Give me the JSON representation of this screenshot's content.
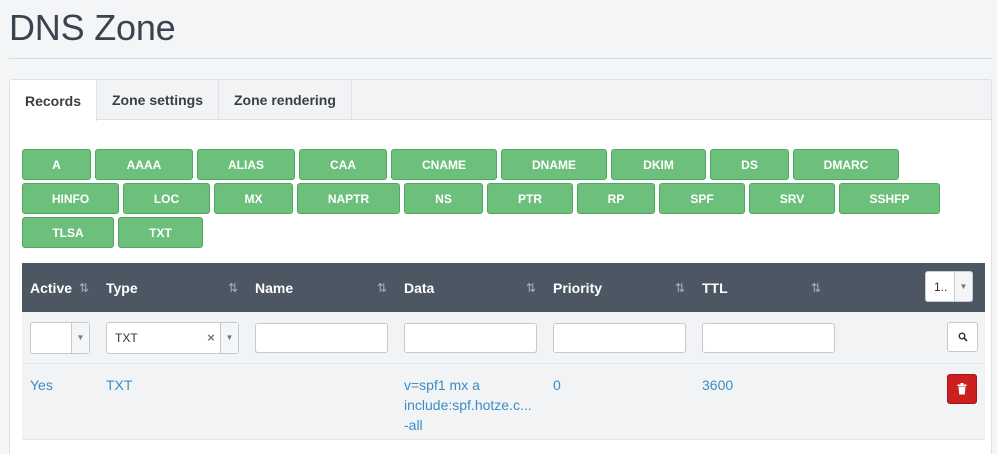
{
  "page": {
    "title": "DNS Zone"
  },
  "tabs": [
    {
      "label": "Records",
      "active": true
    },
    {
      "label": "Zone settings",
      "active": false
    },
    {
      "label": "Zone rendering",
      "active": false
    }
  ],
  "record_types": [
    [
      "A",
      "AAAA",
      "ALIAS",
      "CAA",
      "CNAME",
      "DNAME",
      "DKIM",
      "DS",
      "DMARC"
    ],
    [
      "HINFO",
      "LOC",
      "MX",
      "NAPTR",
      "NS",
      "PTR",
      "RP",
      "SPF",
      "SRV",
      "SSHFP"
    ],
    [
      "TLSA",
      "TXT"
    ]
  ],
  "grid": {
    "columns": {
      "active": "Active",
      "type": "Type",
      "name": "Name",
      "data": "Data",
      "priority": "Priority",
      "ttl": "TTL"
    },
    "page_size": "1..",
    "filters": {
      "active": "",
      "type": "TXT",
      "name": "",
      "data": "",
      "priority": "",
      "ttl": ""
    },
    "rows": [
      {
        "active": "Yes",
        "type": "TXT",
        "name": "",
        "data": [
          "v=spf1 mx a",
          "include:spf.hotze.c...",
          "-all"
        ],
        "priority": "0",
        "ttl": "3600"
      }
    ]
  },
  "icons": {
    "sort": "sort-icon",
    "search": "search-icon",
    "delete": "trash-icon",
    "chevron": "chevron-down-icon",
    "clear": "clear-icon"
  },
  "colors": {
    "record_type_button": "#6dbf7c",
    "grid_header": "#4c5763",
    "link": "#3c8dc5",
    "delete_button": "#cc1f1f"
  }
}
